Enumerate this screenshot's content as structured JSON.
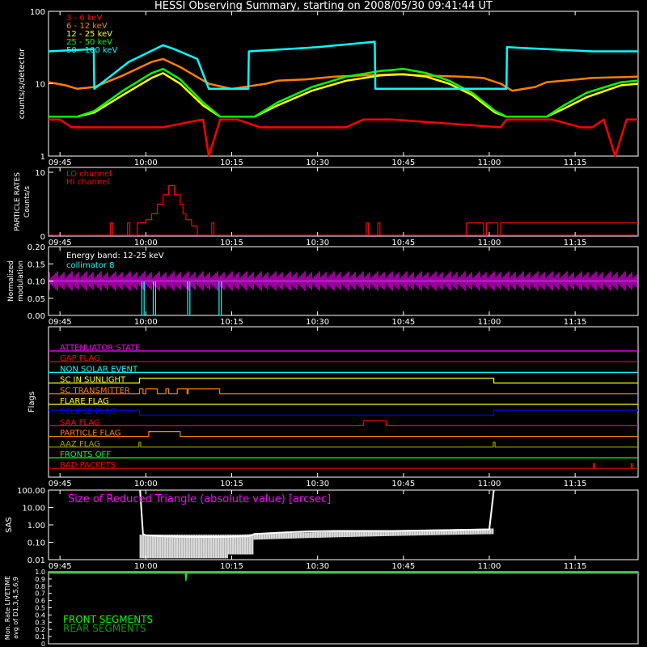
{
  "title": "HESSI Observing Summary, starting on 2008/05/30 09:41:44 UT",
  "time_ticks": [
    "09:45",
    "10:00",
    "10:15",
    "10:30",
    "10:45",
    "11:00",
    "11:15"
  ],
  "colors": {
    "background": "#000000",
    "axes": "#ffffff",
    "red": "#ff0000",
    "orange": "#ff7f00",
    "yellow": "#ffff00",
    "green": "#00ff00",
    "cyan": "#00ffff",
    "magenta": "#ff00ff",
    "blue": "#0000ff",
    "olive": "#a0a000",
    "white": "#ffffff",
    "dark_green": "#00a000"
  },
  "chart_data": [
    {
      "id": "rates",
      "type": "line",
      "ylabel": "counts/s/detector",
      "y_scale": "log",
      "ylim": [
        1,
        100
      ],
      "y_ticks": [
        "1",
        "10",
        "100"
      ],
      "x_unit": "minutes after 09:41:44",
      "xlim": [
        0,
        103
      ],
      "legend_position": "top-left",
      "series": [
        {
          "name": "3 - 6 keV",
          "color": "#ff0000",
          "x": [
            0,
            2,
            4,
            20,
            25,
            27,
            28,
            30,
            33,
            37,
            52,
            55,
            60,
            79,
            80,
            88,
            93,
            95,
            97,
            99,
            101,
            103
          ],
          "y": [
            3.2,
            3.2,
            2.5,
            2.5,
            3.0,
            3.2,
            1.0,
            3.2,
            3.2,
            2.5,
            2.5,
            3.2,
            3.2,
            2.5,
            3.2,
            3.2,
            2.5,
            2.5,
            3.2,
            1.0,
            3.2,
            3.2
          ]
        },
        {
          "name": "6 - 12 keV",
          "color": "#ff7f00",
          "x": [
            0,
            3,
            5,
            8,
            13,
            18,
            20,
            23,
            28,
            32,
            38,
            40,
            45,
            50,
            55,
            61,
            65,
            72,
            76,
            79,
            81,
            85,
            87,
            90,
            95,
            103
          ],
          "y": [
            10.5,
            9.5,
            8.5,
            9.0,
            13.0,
            20.0,
            22.0,
            17.0,
            10.0,
            8.5,
            10.0,
            11.0,
            11.5,
            12.5,
            13.0,
            13.5,
            13.0,
            12.5,
            12.0,
            10.0,
            8.0,
            9.0,
            10.5,
            11.0,
            12.0,
            12.5
          ]
        },
        {
          "name": "12 - 25 keV",
          "color": "#ffff00",
          "x": [
            0,
            3,
            5,
            8,
            13,
            18,
            20,
            23,
            27,
            30,
            36,
            40,
            46,
            52,
            58,
            62,
            66,
            70,
            74,
            78,
            80,
            85,
            87,
            90,
            94,
            100,
            103
          ],
          "y": [
            3.5,
            3.5,
            3.5,
            4.0,
            7.0,
            12.0,
            14.0,
            10.0,
            5.0,
            3.5,
            3.5,
            5.0,
            8.0,
            11.0,
            13.0,
            13.5,
            12.5,
            10.0,
            7.0,
            4.0,
            3.5,
            3.5,
            3.5,
            4.5,
            6.5,
            9.5,
            10.0
          ]
        },
        {
          "name": "25 - 50 keV",
          "color": "#00ff00",
          "x": [
            0,
            3,
            5,
            8,
            13,
            18,
            20,
            23,
            27,
            30,
            36,
            40,
            46,
            52,
            58,
            62,
            66,
            70,
            74,
            78,
            80,
            85,
            87,
            90,
            94,
            100,
            103
          ],
          "y": [
            3.5,
            3.5,
            3.5,
            4.2,
            8.0,
            14.0,
            16.0,
            11.5,
            5.5,
            3.5,
            3.5,
            5.5,
            9.0,
            12.5,
            15.0,
            16.0,
            14.0,
            11.0,
            7.5,
            4.2,
            3.5,
            3.5,
            3.5,
            5.0,
            7.5,
            10.5,
            11.0
          ]
        },
        {
          "name": "50 - 100 keV",
          "color": "#00ffff",
          "x": [
            0,
            7.9,
            8,
            14,
            20,
            22,
            26,
            28,
            34.9,
            35,
            47,
            57,
            57.1,
            75,
            80,
            80.1,
            95,
            103
          ],
          "y": [
            28,
            30,
            8.5,
            20,
            34,
            30,
            22,
            8.5,
            8.5,
            28,
            32,
            38,
            8.5,
            8.5,
            8.5,
            32,
            28,
            28
          ]
        }
      ]
    },
    {
      "id": "particle",
      "type": "line",
      "ylabel_lines": [
        "PARTICLE RATES",
        "Counts/s"
      ],
      "y_scale": "log",
      "ylim": [
        0,
        10
      ],
      "y_ticks": [
        "0",
        "10"
      ],
      "x_unit": "minutes after 09:41:44",
      "xlim": [
        0,
        103
      ],
      "legend_position": "top-left",
      "series": [
        {
          "name": "LO channel",
          "color": "#ff0000",
          "x": [
            0,
            10.8,
            10.8,
            11.2,
            11.2,
            13.8,
            13.8,
            14.2,
            14.2,
            15.5,
            15.5,
            17,
            17,
            18,
            18,
            19,
            19,
            20,
            20,
            21,
            21,
            22,
            22,
            23,
            23,
            23.5,
            23.5,
            24,
            24,
            25,
            25,
            26,
            26,
            28.5,
            28.5,
            28.9,
            28.9,
            55.5,
            55.5,
            55.9,
            55.9,
            57.5,
            57.5,
            57.9,
            57.9,
            73,
            73,
            76,
            76,
            76.5,
            76.5,
            78.5,
            78.5,
            79,
            79,
            103
          ],
          "y": [
            0,
            0,
            2,
            2,
            0,
            0,
            2,
            2,
            0,
            0,
            2,
            2,
            2.5,
            2.5,
            3.5,
            3.5,
            5,
            5,
            6.5,
            6.5,
            8,
            8,
            6.5,
            6.5,
            5,
            5,
            3.5,
            3.5,
            2.5,
            2.5,
            1.5,
            1.5,
            0,
            0,
            2,
            2,
            0,
            0,
            2,
            2,
            0,
            0,
            2,
            2,
            0,
            0,
            2,
            2,
            0,
            0,
            2,
            2,
            0,
            0,
            2,
            2
          ]
        },
        {
          "name": "HI channel",
          "color": "#ff0000",
          "x": [
            0,
            103
          ],
          "y": [
            0,
            0
          ]
        }
      ]
    },
    {
      "id": "modulation",
      "type": "line",
      "ylabel_lines": [
        "Normalized",
        "modulation"
      ],
      "ylim": [
        0,
        0.2
      ],
      "y_ticks": [
        "0.00",
        "0.05",
        "0.10",
        "0.15",
        "0.20"
      ],
      "x_unit": "minutes after 09:41:44",
      "xlim": [
        0,
        103
      ],
      "legend_position": "top-left",
      "series": [
        {
          "name": "Energy band: 12-25 keV",
          "color": "#ffffff",
          "x": [],
          "y": []
        },
        {
          "name": "collimator 8",
          "color": "#00ffff",
          "x": [
            0,
            16.3,
            16.3,
            16.7,
            16.7,
            18.3,
            18.3,
            18.7,
            18.7,
            24.3,
            24.3,
            24.7,
            24.7,
            29.8,
            29.8,
            30.2,
            30.2,
            103
          ],
          "y": [
            0.1,
            0.1,
            0,
            0,
            0.1,
            0.1,
            0,
            0,
            0.1,
            0.1,
            0,
            0,
            0.1,
            0.1,
            0,
            0,
            0.1,
            0.1
          ]
        },
        {
          "name": "",
          "color": "#ff00ff",
          "x": [
            0,
            103
          ],
          "y": [
            0.1,
            0.1
          ]
        }
      ]
    },
    {
      "id": "flags",
      "type": "line",
      "ylabel": "Flags",
      "x_unit": "minutes after 09:41:44",
      "xlim": [
        0,
        103
      ],
      "series": [
        {
          "name": "ATTENUATOR STATE",
          "color": "#ff00ff",
          "x": [
            0,
            103
          ],
          "y": [
            0,
            0
          ]
        },
        {
          "name": "GAP FLAG",
          "color": "#ff0000",
          "x": [
            0,
            103
          ],
          "y": [
            0,
            0
          ]
        },
        {
          "name": "NON SOLAR EVENT",
          "color": "#00ffff",
          "x": [
            0,
            103
          ],
          "y": [
            0,
            0
          ]
        },
        {
          "name": "SC IN SUNLIGHT",
          "color": "#ffff00",
          "x": [
            0,
            15.9,
            15.9,
            77.8,
            77.8,
            103
          ],
          "y": [
            0,
            0,
            1,
            1,
            0,
            0
          ]
        },
        {
          "name": "SC TRANSMITTER",
          "color": "#ff7f00",
          "x": [
            0,
            15.9,
            15.9,
            16.5,
            16.5,
            17,
            17,
            19,
            19,
            20.5,
            20.5,
            21,
            21,
            22.5,
            22.5,
            23.5,
            23.5,
            24.2,
            24.2,
            24.4,
            24.4,
            24.9,
            24.9,
            29.9,
            29.9,
            103
          ],
          "y": [
            0,
            0,
            1,
            1,
            0,
            0,
            1,
            1,
            0,
            0,
            1,
            1,
            0,
            0,
            1,
            1,
            1,
            1,
            0,
            0,
            1,
            1,
            1,
            1,
            0,
            0
          ]
        },
        {
          "name": "FLARE FLAG",
          "color": "#ffff00",
          "x": [
            0,
            103
          ],
          "y": [
            0,
            0
          ]
        },
        {
          "name": "ECLIPSE FLAG",
          "color": "#0000ff",
          "x": [
            0,
            15.9,
            15.9,
            77.8,
            77.8,
            103
          ],
          "y": [
            1,
            1,
            0,
            0,
            1,
            1
          ]
        },
        {
          "name": "SAA FLAG",
          "color": "#ff0000",
          "x": [
            0,
            55,
            55,
            59,
            59,
            103
          ],
          "y": [
            0,
            0,
            1,
            1,
            0,
            0
          ]
        },
        {
          "name": "PARTICLE FLAG",
          "color": "#ff7f00",
          "x": [
            0,
            17.5,
            17.5,
            23,
            23,
            103
          ],
          "y": [
            0,
            0,
            1,
            1,
            0,
            0
          ]
        },
        {
          "name": "AAZ FLAG",
          "color": "#a0a000",
          "x": [
            0,
            15.8,
            15.8,
            16.1,
            16.1,
            77.7,
            77.7,
            78,
            78,
            103
          ],
          "y": [
            0,
            0,
            1,
            1,
            0,
            0,
            1,
            1,
            0,
            0
          ]
        },
        {
          "name": "FRONTS OFF",
          "color": "#00ff00",
          "x": [
            0,
            103
          ],
          "y": [
            0,
            0
          ]
        },
        {
          "name": "BAD PACKETS",
          "color": "#ff0000",
          "x": [
            0,
            95.2,
            95.2,
            95.4,
            95.4,
            101.8,
            101.8,
            102,
            102,
            103
          ],
          "y": [
            0,
            0,
            1,
            1,
            0,
            0,
            1,
            1,
            0,
            0
          ]
        }
      ]
    },
    {
      "id": "sas",
      "type": "line",
      "ylabel": "SAS",
      "y_scale": "log",
      "ylim": [
        0.01,
        100
      ],
      "y_ticks": [
        "0.01",
        "0.10",
        "1.00",
        "10.00",
        "100.00"
      ],
      "x_unit": "minutes after 09:41:44",
      "xlim": [
        0,
        103
      ],
      "legend_position": "top-left",
      "series": [
        {
          "name": "Size of Reduced Triangle (absolute value) [arcsec]",
          "color": "#ffffff",
          "x": [
            16,
            16.5,
            17,
            20,
            25,
            30,
            35,
            36,
            40,
            45,
            50,
            60,
            70,
            77,
            77.8
          ],
          "y": [
            100,
            0.3,
            0.25,
            0.22,
            0.2,
            0.2,
            0.22,
            0.3,
            0.35,
            0.42,
            0.45,
            0.45,
            0.5,
            0.55,
            100
          ]
        }
      ]
    },
    {
      "id": "livetime",
      "type": "line",
      "ylabel_lines": [
        "Mon. Rate LIVETIME",
        "avg of D1,3,4,5,6,9"
      ],
      "ylim": [
        0,
        1
      ],
      "y_ticks": [
        "0",
        "0.1",
        "0.2",
        "0.3",
        "0.4",
        "0.5",
        "0.6",
        "0.7",
        "0.8",
        "0.9",
        "1.0"
      ],
      "x_unit": "minutes after 09:41:44",
      "xlim": [
        0,
        103
      ],
      "legend_position": "bottom-left",
      "series": [
        {
          "name": "FRONT SEGMENTS",
          "color": "#00ff00",
          "x": [
            0,
            23.9,
            24,
            24.1,
            103
          ],
          "y": [
            0.98,
            0.98,
            0.88,
            0.98,
            0.98
          ]
        },
        {
          "name": "REAR SEGMENTS",
          "color": "#00a000",
          "x": [
            0,
            103
          ],
          "y": [
            0.985,
            0.985
          ]
        }
      ]
    }
  ]
}
